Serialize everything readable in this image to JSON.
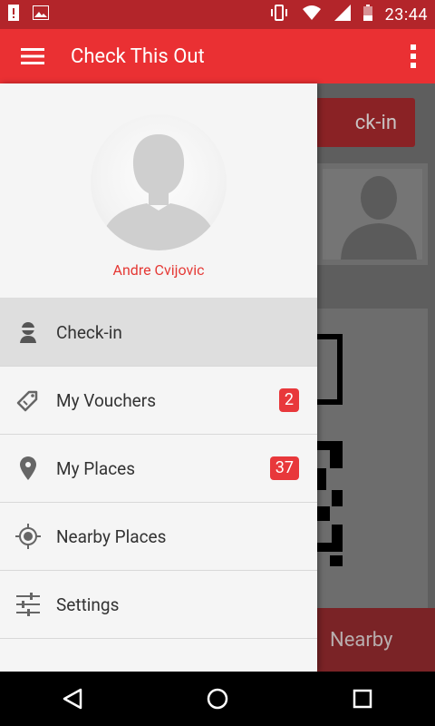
{
  "status_bar": {
    "time": "23:44",
    "icons": [
      "alert-icon",
      "image-icon",
      "vibrate-icon",
      "wifi-icon",
      "signal-icon",
      "battery-icon"
    ]
  },
  "app_bar": {
    "title": "Check This Out",
    "menu_icon": "hamburger-menu-icon",
    "overflow_icon": "overflow-menu-icon"
  },
  "background": {
    "checkin_button_label": "ck-in",
    "nearby_label": "Nearby"
  },
  "drawer": {
    "profile": {
      "name": "Andre Cvijovic"
    },
    "items": [
      {
        "label": "Check-in",
        "icon": "person-icon",
        "active": true,
        "badge": null
      },
      {
        "label": "My Vouchers",
        "icon": "tag-icon",
        "active": false,
        "badge": "2"
      },
      {
        "label": "My Places",
        "icon": "location-pin-icon",
        "active": false,
        "badge": "37"
      },
      {
        "label": "Nearby Places",
        "icon": "gps-target-icon",
        "active": false,
        "badge": null
      },
      {
        "label": "Settings",
        "icon": "sliders-icon",
        "active": false,
        "badge": null
      }
    ]
  },
  "colors": {
    "accent": "#ea3033",
    "status_bar": "#b3252a",
    "name_text": "#e53935",
    "badge": "#e8383b"
  },
  "nav_bar": {
    "icons": [
      "back-icon",
      "home-icon",
      "recents-icon"
    ]
  }
}
